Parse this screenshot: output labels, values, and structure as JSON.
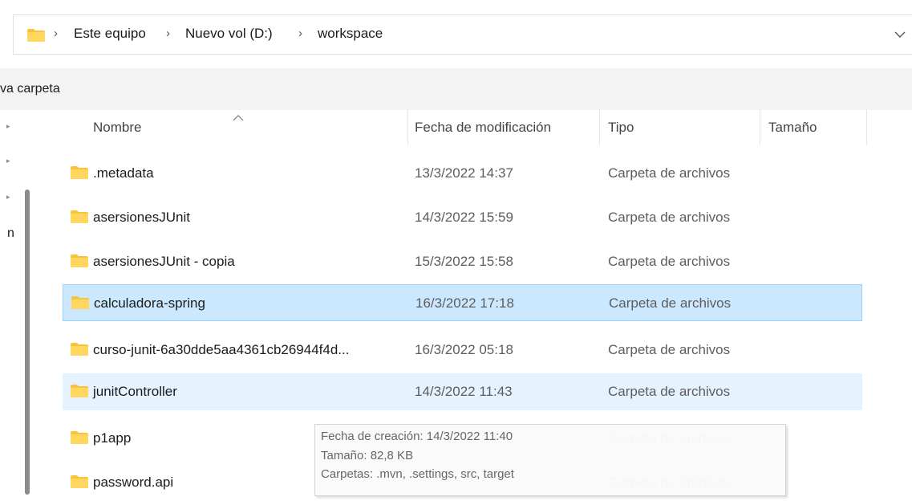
{
  "breadcrumb": {
    "items": [
      "Este equipo",
      "Nuevo vol (D:)",
      "workspace"
    ]
  },
  "toolbar": {
    "new_folder_label": "va carpeta"
  },
  "left_pane": {
    "partial_label": "n"
  },
  "columns": {
    "name": "Nombre",
    "date": "Fecha de modificación",
    "type": "Tipo",
    "size": "Tamaño"
  },
  "rows": [
    {
      "name": ".metadata",
      "date": "13/3/2022 14:37",
      "type": "Carpeta de archivos"
    },
    {
      "name": "asersionesJUnit",
      "date": "14/3/2022 15:59",
      "type": "Carpeta de archivos"
    },
    {
      "name": "asersionesJUnit - copia",
      "date": "15/3/2022 15:58",
      "type": "Carpeta de archivos"
    },
    {
      "name": "calculadora-spring",
      "date": "16/3/2022 17:18",
      "type": "Carpeta de archivos",
      "state": "selected"
    },
    {
      "name": "curso-junit-6a30dde5aa4361cb26944f4d...",
      "date": "16/3/2022 05:18",
      "type": "Carpeta de archivos"
    },
    {
      "name": "junitController",
      "date": "14/3/2022 11:43",
      "type": "Carpeta de archivos",
      "state": "hover"
    },
    {
      "name": "p1app",
      "date": "",
      "type": "Carpeta de archivos"
    },
    {
      "name": "password.api",
      "date": "",
      "type": "Carpeta de archivos"
    }
  ],
  "tooltip": {
    "line1": "Fecha de creación: 14/3/2022 11:40",
    "line2": "Tamaño: 82,8 KB",
    "line3": "Carpetas: .mvn, .settings, src, target"
  },
  "colors": {
    "selected_bg": "#cce8ff",
    "selected_border": "#99d1ff",
    "hover_bg": "#e5f3ff",
    "folder_yellow": "#f8c43a"
  },
  "icons": {
    "folder": "folder-icon",
    "chevron_right": "chevron-right-icon",
    "chevron_down": "chevron-down-icon",
    "sort": "sort-ascending-icon"
  }
}
